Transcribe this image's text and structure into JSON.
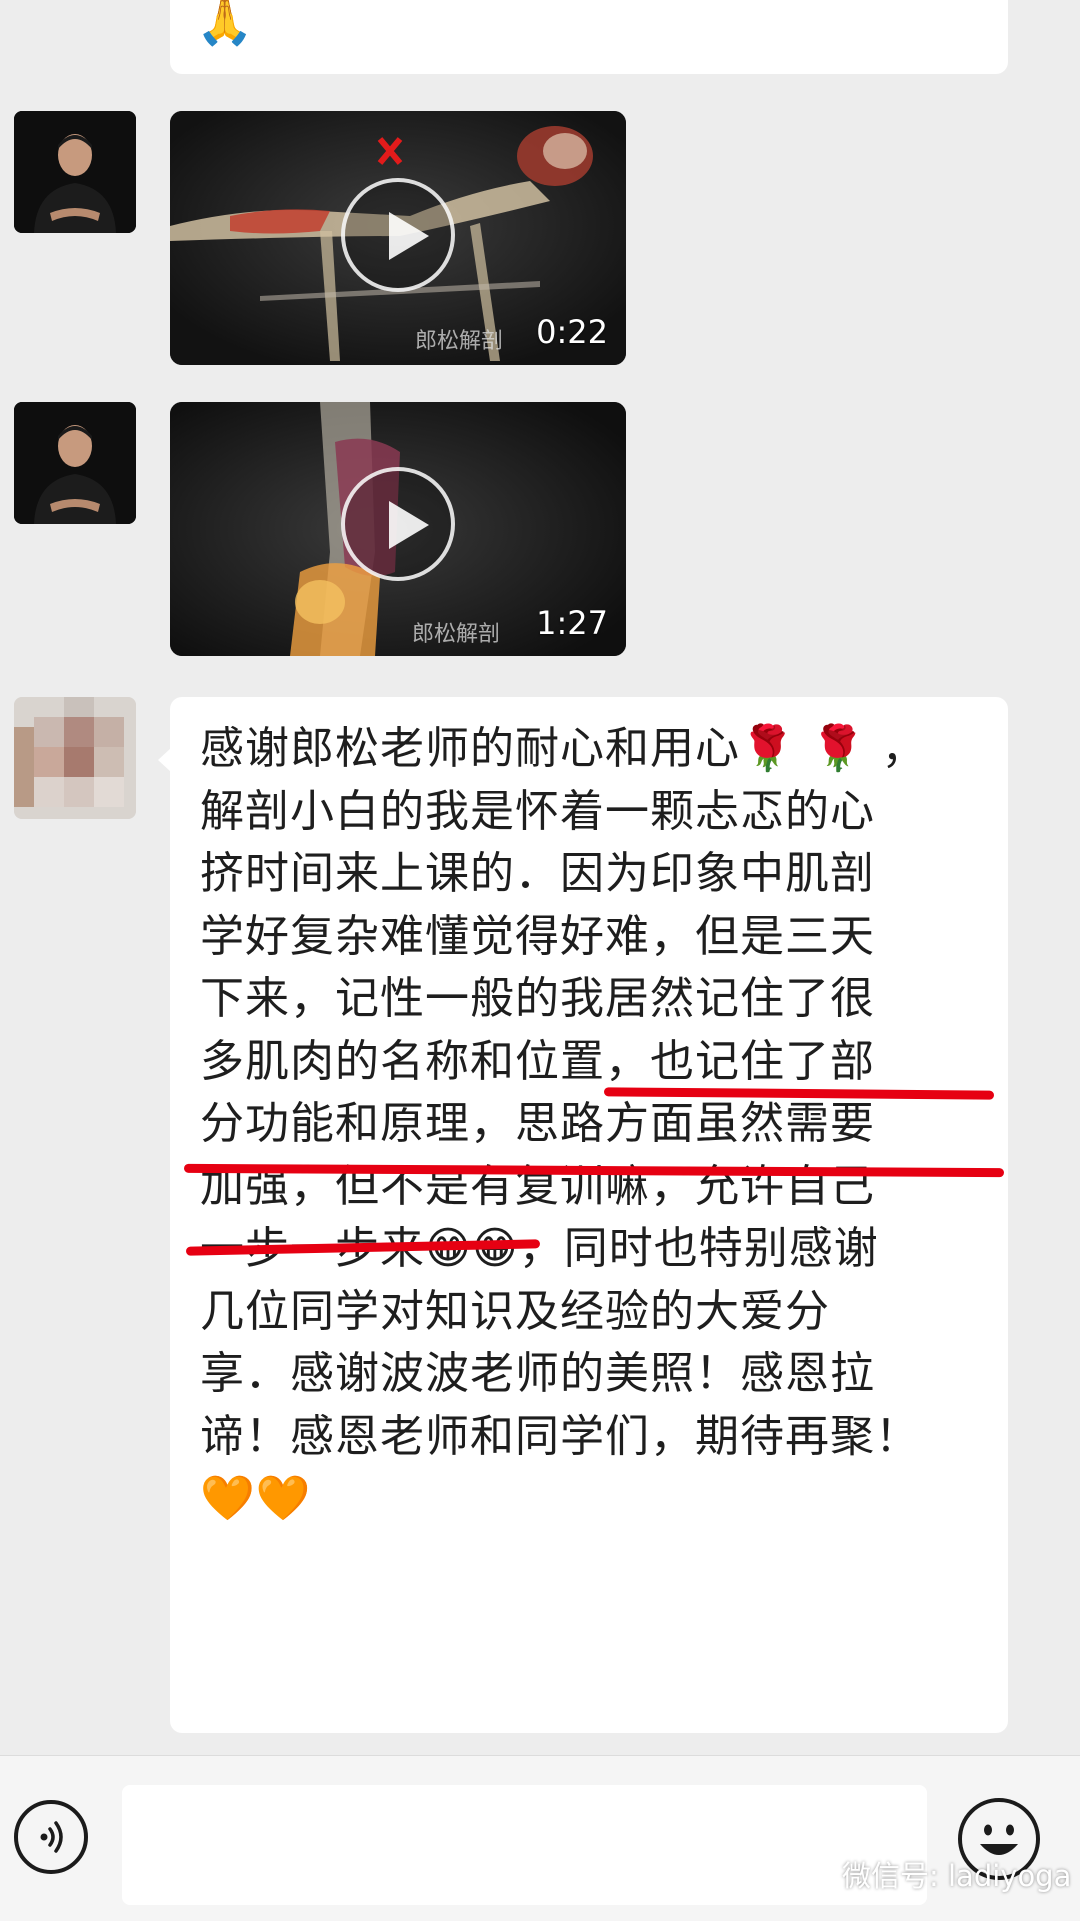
{
  "colors": {
    "background": "#ededed",
    "bubble": "#ffffff",
    "underline": "#e60012",
    "text": "#1e1e1e"
  },
  "messages": {
    "top_bubble": {
      "emoji": "🙏"
    },
    "video1": {
      "duration": "0:22",
      "caption": "郎松解剖",
      "icon": "play-icon"
    },
    "video2": {
      "duration": "1:27",
      "caption": "郎松解剖",
      "icon": "play-icon"
    },
    "text_message": {
      "lines": [
        "感谢郎松老师的耐心和用心🌹 🌹 ，",
        "解剖小白的我是怀着一颗忐忑的心",
        "挤时间来上课的．因为印象中肌剖",
        "学好复杂难懂觉得好难，但是三天",
        "下来，记性一般的我居然记住了很",
        "多肌肉的名称和位置，也记住了部",
        "分功能和原理，思路方面虽然需要",
        "加强，但不是有复训嘛，允许自己",
        "一步一步来😁😁，同时也特别感谢",
        "几位同学对知识及经验的大爱分",
        "享．感谢波波老师的美照！感恩拉",
        "谛！感恩老师和同学们，期待再聚！",
        "🧡🧡"
      ]
    }
  },
  "bottom_bar": {
    "voice_icon": "voice-icon",
    "emoji_icon": "emoji-icon"
  },
  "watermark": {
    "text": "微信号: ladiyoga",
    "icon": "wechat-icon"
  }
}
